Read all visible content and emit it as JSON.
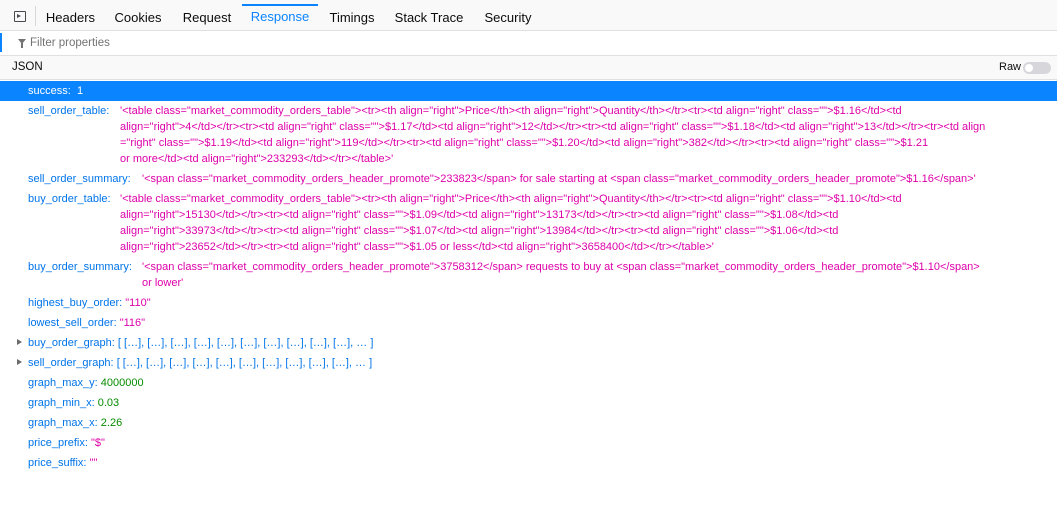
{
  "tabs": [
    "Headers",
    "Cookies",
    "Request",
    "Response",
    "Timings",
    "Stack Trace",
    "Security"
  ],
  "filter": {
    "placeholder": "Filter properties"
  },
  "json_header": {
    "label": "JSON",
    "raw_label": "Raw"
  },
  "rows": {
    "success": {
      "key": "success:",
      "value": "1"
    },
    "sell_order_table": {
      "key": "sell_order_table:",
      "l1": "'<table class=\"market_commodity_orders_table\"><tr><th align=\"right\">Price</th><th align=\"right\">Quantity</th></tr><tr><td align=\"right\" class=\"\">$1.16</td><td",
      "l2": "align=\"right\">4</td></tr><tr><td align=\"right\" class=\"\">$1.17</td><td align=\"right\">12</td></tr><tr><td align=\"right\" class=\"\">$1.18</td><td align=\"right\">13</td></tr><tr><td align",
      "l3": "=\"right\" class=\"\">$1.19</td><td align=\"right\">119</td></tr><tr><td align=\"right\" class=\"\">$1.20</td><td align=\"right\">382</td></tr><tr><td align=\"right\" class=\"\">$1.21",
      "l4": "or more</td><td align=\"right\">233293</td></tr></table>'"
    },
    "sell_order_summary": {
      "key": "sell_order_summary:",
      "value": "'<span class=\"market_commodity_orders_header_promote\">233823</span> for sale starting at <span class=\"market_commodity_orders_header_promote\">$1.16</span>'"
    },
    "buy_order_table": {
      "key": "buy_order_table:",
      "l1": "'<table class=\"market_commodity_orders_table\"><tr><th align=\"right\">Price</th><th align=\"right\">Quantity</th></tr><tr><td align=\"right\" class=\"\">$1.10</td><td",
      "l2": "align=\"right\">15130</td></tr><tr><td align=\"right\" class=\"\">$1.09</td><td align=\"right\">13173</td></tr><tr><td align=\"right\" class=\"\">$1.08</td><td",
      "l3": "align=\"right\">33973</td></tr><tr><td align=\"right\" class=\"\">$1.07</td><td align=\"right\">13984</td></tr><tr><td align=\"right\" class=\"\">$1.06</td><td",
      "l4": "align=\"right\">23652</td></tr><tr><td align=\"right\" class=\"\">$1.05 or less</td><td align=\"right\">3658400</td></tr></table>'"
    },
    "buy_order_summary": {
      "key": "buy_order_summary:",
      "l1": "'<span class=\"market_commodity_orders_header_promote\">3758312</span> requests to buy at <span class=\"market_commodity_orders_header_promote\">$1.10</span>",
      "l2": "or lower'"
    },
    "highest_buy_order": {
      "key": "highest_buy_order:",
      "value": "\"110\""
    },
    "lowest_sell_order": {
      "key": "lowest_sell_order:",
      "value": "\"116\""
    },
    "buy_order_graph": {
      "key": "buy_order_graph:",
      "value": "[ […], […], […], […], […], […], […], […], […], […], … ]"
    },
    "sell_order_graph": {
      "key": "sell_order_graph:",
      "value": "[ […], […], […], […], […], […], […], […], […], […], … ]"
    },
    "graph_max_y": {
      "key": "graph_max_y:",
      "value": "4000000"
    },
    "graph_min_x": {
      "key": "graph_min_x:",
      "value": "0.03"
    },
    "graph_max_x": {
      "key": "graph_max_x:",
      "value": "2.26"
    },
    "price_prefix": {
      "key": "price_prefix:",
      "value": "\"$\""
    },
    "price_suffix": {
      "key": "price_suffix:",
      "value": "\"\""
    }
  },
  "colors": {
    "accent": "#0a84ff",
    "key": "#0074e8",
    "string": "#dd00a9",
    "number": "#058b00"
  }
}
